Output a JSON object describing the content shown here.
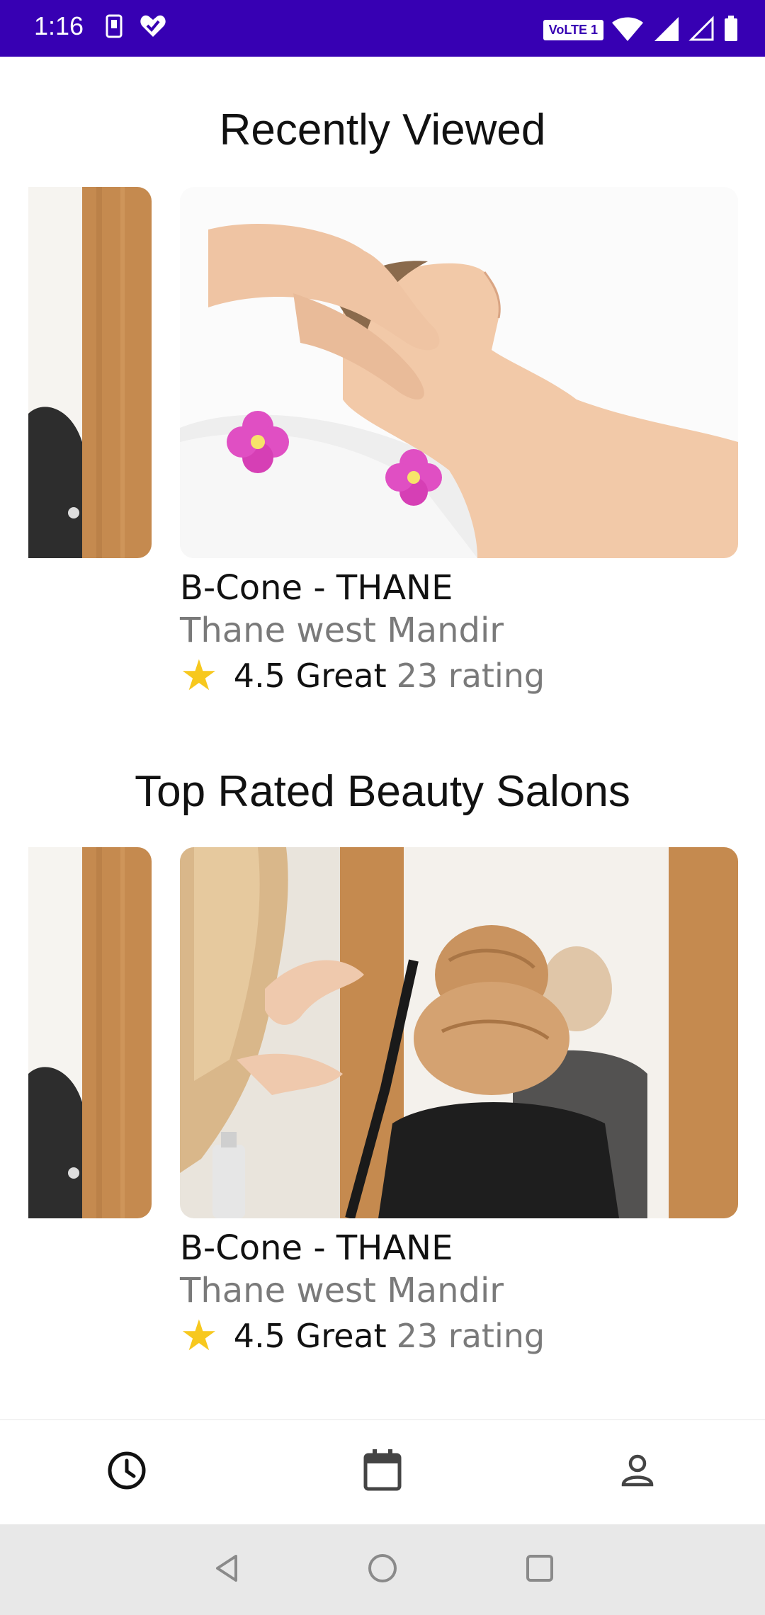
{
  "status_bar": {
    "time": "1:16",
    "volte": "VoLTE 1",
    "icons_left": [
      "sim-icon",
      "heart-icon"
    ],
    "icons_right": [
      "volte-badge",
      "wifi-icon",
      "signal-icon",
      "signal-empty-icon",
      "battery-icon"
    ]
  },
  "sections": [
    {
      "title": "Recently Viewed",
      "card": {
        "name": "B-Cone - THANE",
        "location": "Thane west Mandir",
        "rating_value": "4.5 Great",
        "rating_count": "23 rating",
        "image": "spa-massage-image"
      }
    },
    {
      "title": "Top Rated Beauty Salons",
      "card": {
        "name": "B-Cone - THANE",
        "location": "Thane west Mandir",
        "rating_value": "4.5 Great",
        "rating_count": "23 rating",
        "image": "hair-styling-image"
      }
    }
  ],
  "bottom_nav": {
    "items": [
      "clock-icon",
      "calendar-icon",
      "person-icon"
    ],
    "active": "clock-icon"
  },
  "system_nav": {
    "buttons": [
      "back-icon",
      "home-icon",
      "recents-icon"
    ]
  },
  "colors": {
    "status_bar": "#3700b3",
    "star": "#f7c81e",
    "secondary_text": "#7a7a7a"
  }
}
